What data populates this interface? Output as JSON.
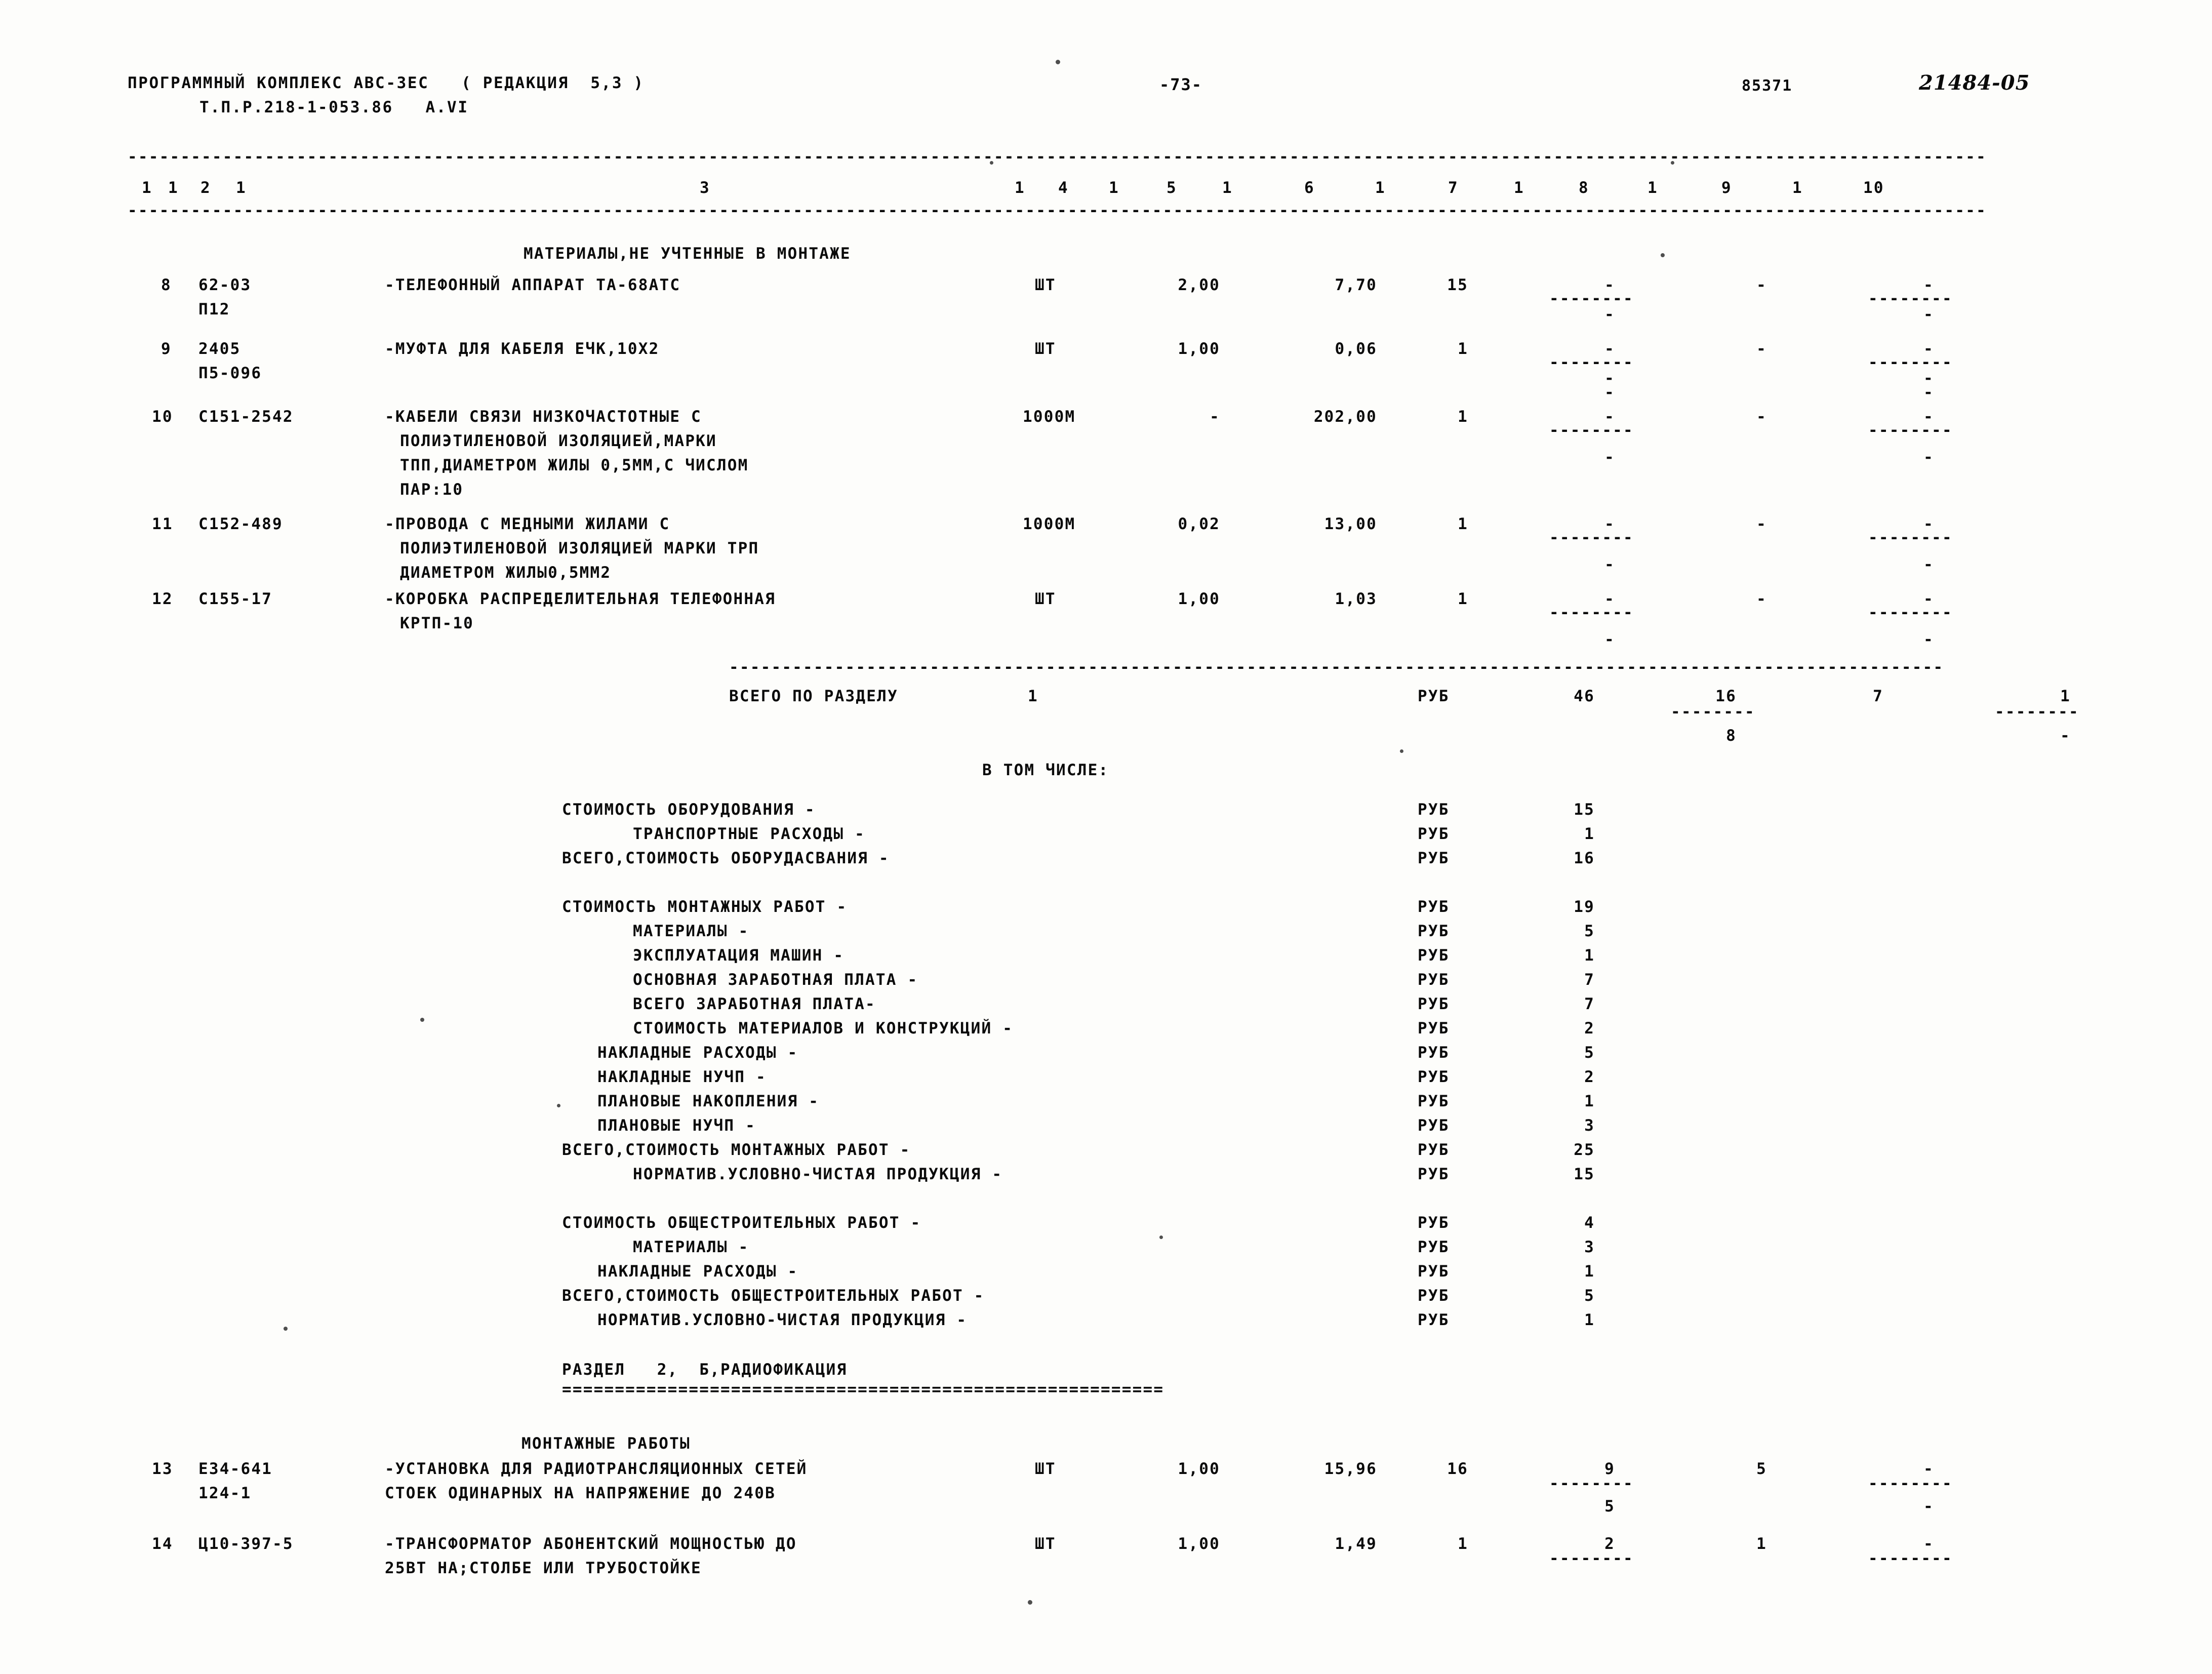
{
  "header": {
    "program_line1": "ПРОГРАММНЫЙ КОМПЛЕКС АВС-3ЕС   ( РЕДАКЦИЯ  5,3 )",
    "program_line2": "Т.П.Р.218-1-053.86   А.VI",
    "page_number": "-73-",
    "stamp_number": "85371",
    "stamp_code": "21484-05"
  },
  "columns": {
    "left_group": "1  1    2    1                             3                          1   4    1   5    1    6    1   7",
    "right_group": "1   8    1   9    1   10"
  },
  "column_headers": [
    "1",
    "2",
    "3",
    "4",
    "5",
    "6",
    "7",
    "8",
    "9",
    "10"
  ],
  "section_titles": {
    "materials_not_counted": "МАТЕРИАЛЫ,НЕ УЧТЕННЫЕ В МОНТАЖЕ",
    "total_by_section_label": "ВСЕГО ПО РАЗДЕЛУ",
    "total_by_section_number": "1",
    "in_that_number": "В ТОМ ЧИСЛЕ:",
    "section2_heading": "РАЗДЕЛ   2,  Б,РАДИОФИКАЦИЯ",
    "assembly_works": "МОНТАЖНЫЕ РАБОТЫ"
  },
  "rows": [
    {
      "no": "8",
      "code": "62-03",
      "code2": "П12",
      "desc": [
        "-ТЕЛЕФОННЫЙ АППАРАТ ТА-68АТС"
      ],
      "unit": "ШТ",
      "qty": "2,00",
      "price": "7,70",
      "c7": "15",
      "c8": "-",
      "c9": "-",
      "c10": "-"
    },
    {
      "no": "9",
      "code": "2405",
      "code2": "П5-096",
      "desc": [
        "-МУФТА ДЛЯ КАБЕЛЯ ЕЧК,10Х2"
      ],
      "unit": "ШТ",
      "qty": "1,00",
      "price": "0,06",
      "c7": "1",
      "c8": "-",
      "c9": "-",
      "c10": "-"
    },
    {
      "no": "10",
      "code": "С151-2542",
      "code2": "",
      "desc": [
        "-КАБЕЛИ СВЯЗИ НИЗКОЧАСТОТНЫЕ С",
        "ПОЛИЭТИЛЕНОВОЙ ИЗОЛЯЦИЕЙ,МАРКИ",
        "ТПП,ДИАМЕТРОМ ЖИЛЫ 0,5ММ,С ЧИСЛОМ",
        "ПАР:10"
      ],
      "unit": "1000М",
      "qty": "-",
      "price": "202,00",
      "c7": "1",
      "c8": "-",
      "c9": "-",
      "c10": "-"
    },
    {
      "no": "11",
      "code": "С152-489",
      "code2": "",
      "desc": [
        "-ПРОВОДА С МЕДНЫМИ ЖИЛАМИ С",
        "ПОЛИЭТИЛЕНОВОЙ ИЗОЛЯЦИЕЙ МАРКИ ТРП",
        "ДИАМЕТРОМ ЖИЛЫ0,5ММ2"
      ],
      "unit": "1000М",
      "qty": "0,02",
      "price": "13,00",
      "c7": "1",
      "c8": "-",
      "c9": "-",
      "c10": "-"
    },
    {
      "no": "12",
      "code": "С155-17",
      "code2": "",
      "desc": [
        "-КОРОБКА РАСПРЕДЕЛИТЕЛЬНАЯ ТЕЛЕФОННАЯ",
        "КРТП-10"
      ],
      "unit": "ШТ",
      "qty": "1,00",
      "price": "1,03",
      "c7": "1",
      "c8": "-",
      "c9": "-",
      "c10": "-"
    }
  ],
  "total_row": {
    "unit": "РУБ",
    "c7": "46",
    "c8": "16",
    "c9": "7",
    "c10": "1",
    "c8_sub": "8",
    "c10_sub": "-"
  },
  "breakdown": [
    {
      "label": "СТОИМОСТЬ ОБОРУДОВАНИЯ -",
      "indent": 0,
      "unit": "РУБ",
      "value": "15"
    },
    {
      "label": "ТРАНСПОРТНЫЕ РАСХОДЫ -",
      "indent": 1,
      "unit": "РУБ",
      "value": "1"
    },
    {
      "label": "ВСЕГО,СТОИМОСТЬ ОБОРУДАСВАНИЯ -",
      "indent": 0,
      "unit": "РУБ",
      "value": "16"
    },
    {
      "label": "",
      "indent": 0,
      "unit": "",
      "value": ""
    },
    {
      "label": "СТОИМОСТЬ МОНТАЖНЫХ РАБОТ -",
      "indent": 0,
      "unit": "РУБ",
      "value": "19"
    },
    {
      "label": "МАТЕРИАЛЫ -",
      "indent": 1,
      "unit": "РУБ",
      "value": "5"
    },
    {
      "label": "ЭКСПЛУАТАЦИЯ МАШИН -",
      "indent": 1,
      "unit": "РУБ",
      "value": "1"
    },
    {
      "label": "ОСНОВНАЯ ЗАРАБОТНАЯ ПЛАТА -",
      "indent": 1,
      "unit": "РУБ",
      "value": "7"
    },
    {
      "label": "ВСЕГО ЗАРАБОТНАЯ ПЛАТА-",
      "indent": 1,
      "unit": "РУБ",
      "value": "7"
    },
    {
      "label": "СТОИМОСТЬ МАТЕРИАЛОВ И КОНСТРУКЦИЙ -",
      "indent": 1,
      "unit": "РУБ",
      "value": "2"
    },
    {
      "label": "НАКЛАДНЫЕ РАСХОДЫ -",
      "indent": 2,
      "unit": "РУБ",
      "value": "5"
    },
    {
      "label": "НАКЛАДНЫЕ НУЧП -",
      "indent": 2,
      "unit": "РУБ",
      "value": "2"
    },
    {
      "label": "ПЛАНОВЫЕ НАКОПЛЕНИЯ -",
      "indent": 2,
      "unit": "РУБ",
      "value": "1"
    },
    {
      "label": "ПЛАНОВЫЕ НУЧП -",
      "indent": 2,
      "unit": "РУБ",
      "value": "3"
    },
    {
      "label": "ВСЕГО,СТОИМОСТЬ МОНТАЖНЫХ РАБОТ -",
      "indent": 0,
      "unit": "РУБ",
      "value": "25"
    },
    {
      "label": "НОРМАТИВ.УСЛОВНО-ЧИСТАЯ ПРОДУКЦИЯ -",
      "indent": 1,
      "unit": "РУБ",
      "value": "15"
    },
    {
      "label": "",
      "indent": 0,
      "unit": "",
      "value": ""
    },
    {
      "label": "СТОИМОСТЬ ОБЩЕСТРОИТЕЛЬНЫХ РАБОТ -",
      "indent": 0,
      "unit": "РУБ",
      "value": "4"
    },
    {
      "label": "МАТЕРИАЛЫ -",
      "indent": 1,
      "unit": "РУБ",
      "value": "3"
    },
    {
      "label": "НАКЛАДНЫЕ РАСХОДЫ -",
      "indent": 2,
      "unit": "РУБ",
      "value": "1"
    },
    {
      "label": "ВСЕГО,СТОИМОСТЬ ОБЩЕСТРОИТЕЛЬНЫХ РАБОТ -",
      "indent": 0,
      "unit": "РУБ",
      "value": "5"
    },
    {
      "label": "НОРМАТИВ.УСЛОВНО-ЧИСТАЯ ПРОДУКЦИЯ -",
      "indent": 2,
      "unit": "РУБ",
      "value": "1"
    }
  ],
  "rows_section2": [
    {
      "no": "13",
      "code": "Е34-641",
      "code2": "124-1",
      "desc": [
        "-УСТАНОВКА ДЛЯ РАДИОТРАНСЛЯЦИОННЫХ СЕТЕЙ",
        "СТОЕК ОДИНАРНЫХ НА НАПРЯЖЕНИЕ ДО 240В"
      ],
      "unit": "ШТ",
      "qty": "1,00",
      "price": "15,96",
      "c7": "16",
      "c8": "9",
      "c9": "5",
      "c10": "-",
      "c8_sub": "5",
      "c10_sub": "-"
    },
    {
      "no": "14",
      "code": "Ц10-397-5",
      "code2": "",
      "desc": [
        "-ТРАНСФОРМАТОР АБОНЕНТСКИЙ МОЩНОСТЬЮ ДО",
        "25ВТ НА;СТОЛБЕ ИЛИ ТРУБОСТОЙКЕ"
      ],
      "unit": "ШТ",
      "qty": "1,00",
      "price": "1,49",
      "c7": "1",
      "c8": "2",
      "c9": "1",
      "c10": "-"
    }
  ]
}
